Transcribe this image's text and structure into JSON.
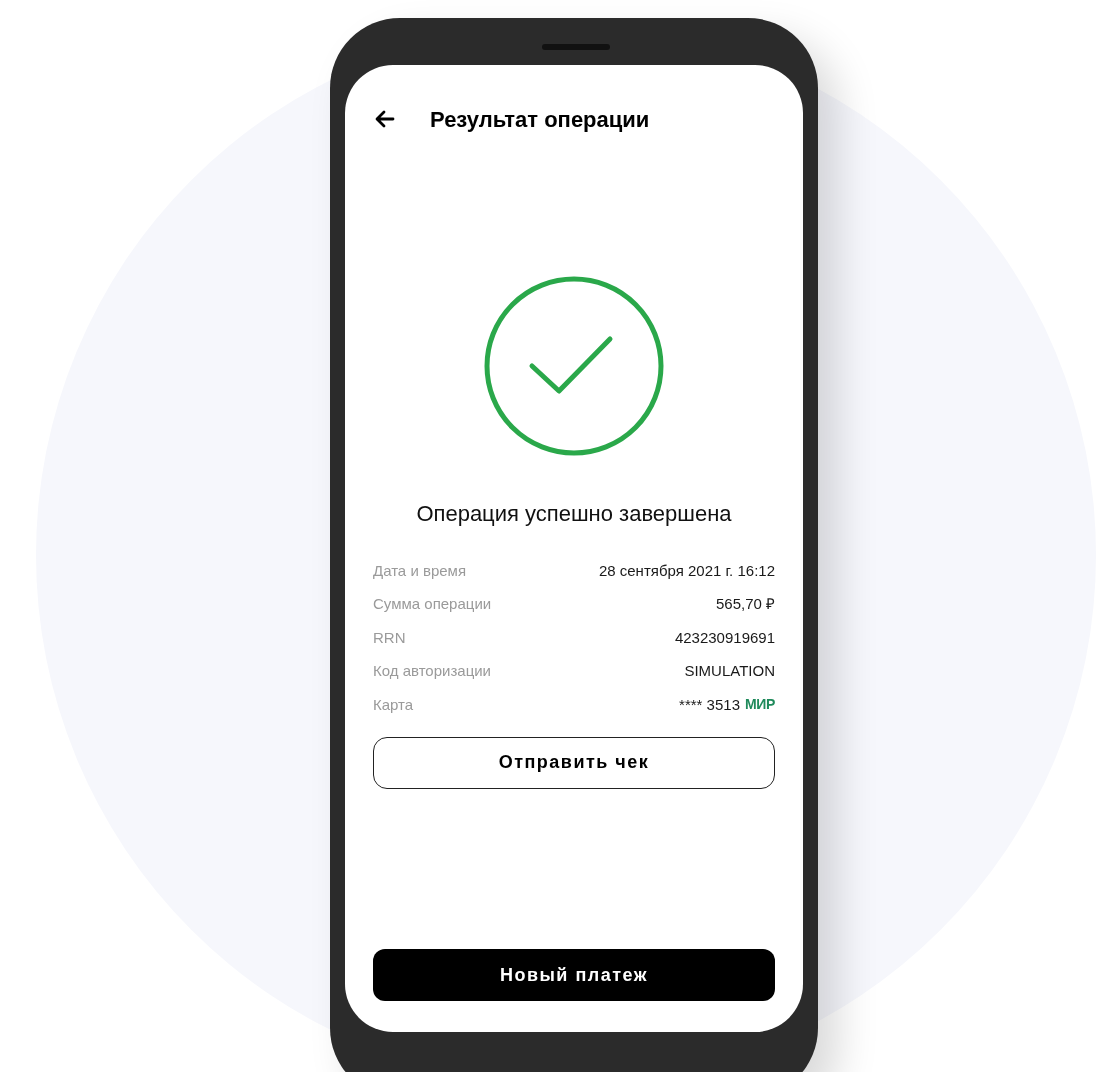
{
  "header": {
    "title": "Результат операции"
  },
  "status": {
    "kind": "success",
    "message": "Операция успешно завершена"
  },
  "details": [
    {
      "label": "Дата и время",
      "value": "28 сентября 2021 г. 16:12"
    },
    {
      "label": "Сумма операции",
      "value": "565,70 ₽"
    },
    {
      "label": "RRN",
      "value": "423230919691"
    },
    {
      "label": "Код авторизации",
      "value": "SIMULATION"
    },
    {
      "label": "Карта",
      "value": "**** 3513",
      "brand": "МИР"
    }
  ],
  "buttons": [
    {
      "label": "Отправить чек",
      "kind": "outline"
    },
    {
      "label": "Новый платеж",
      "kind": "primary"
    }
  ]
}
